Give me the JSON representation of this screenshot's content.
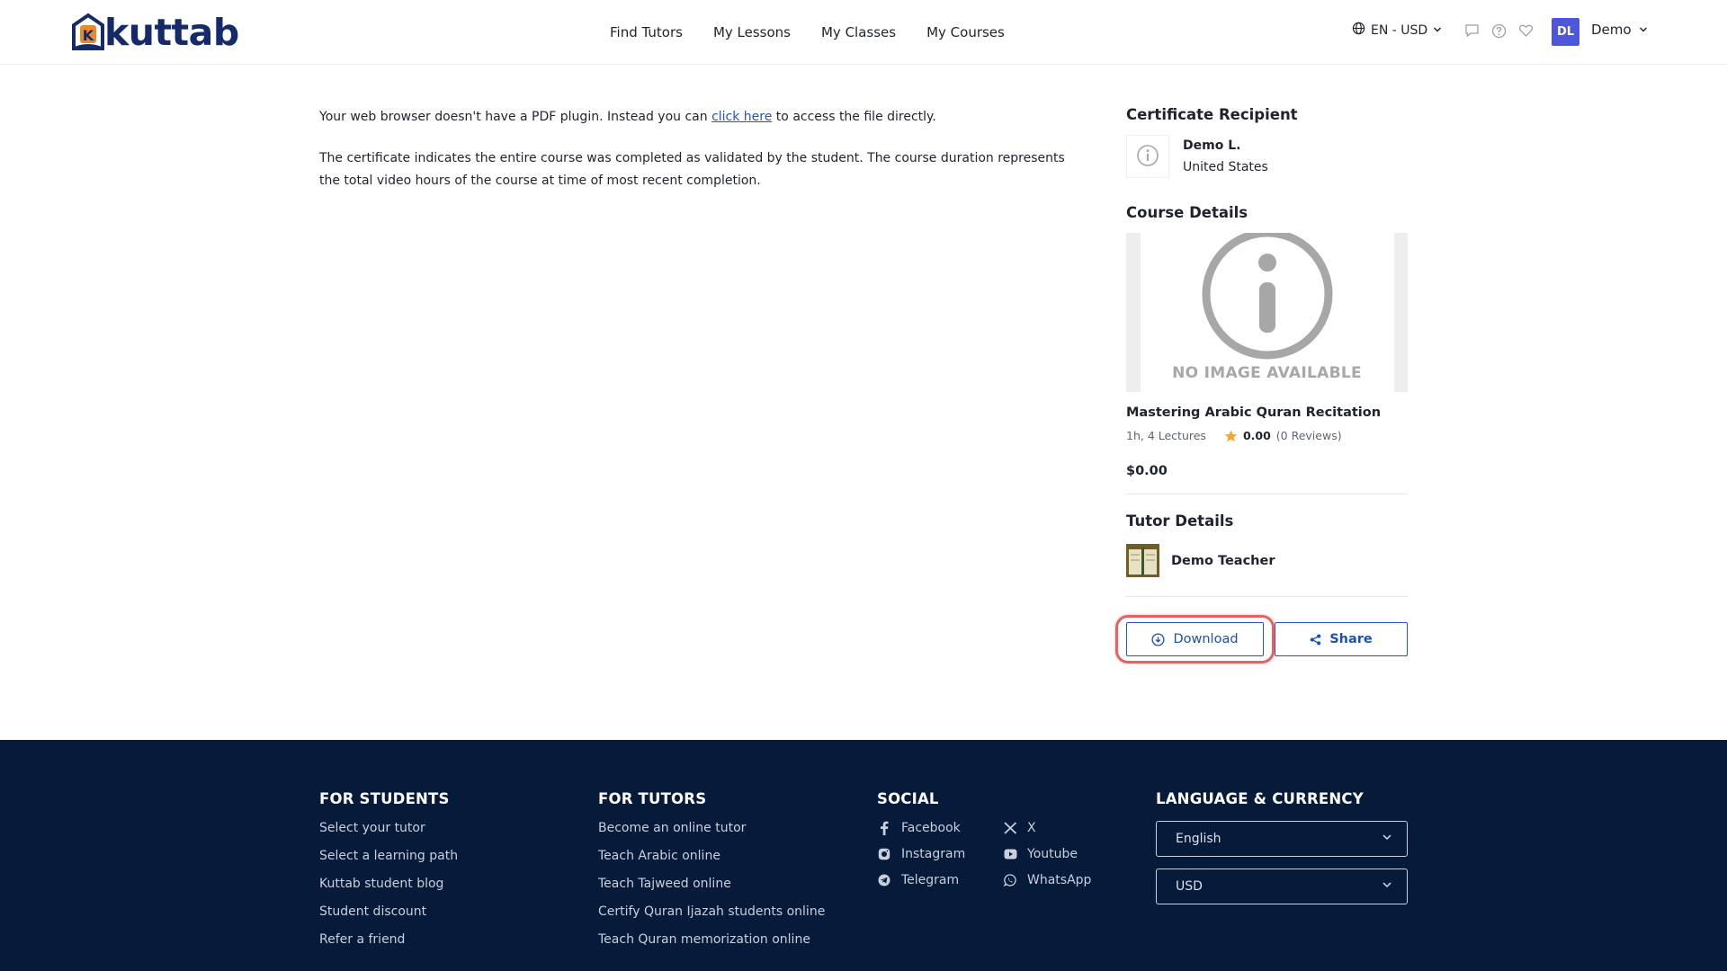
{
  "header": {
    "logo_text": "kuttab",
    "nav": [
      "Find Tutors",
      "My Lessons",
      "My Classes",
      "My Courses"
    ],
    "lang_currency": "EN - USD",
    "avatar_initials": "DL",
    "user_name": "Demo"
  },
  "main": {
    "pdf_notice_before": "Your web browser doesn't have a PDF plugin. Instead you can ",
    "pdf_notice_link": "click here",
    "pdf_notice_after": " to access the file directly.",
    "certificate_note": "The certificate indicates the entire course was completed as validated by the student. The course duration represents the total video hours of the course at time of most recent completion."
  },
  "sidebar": {
    "recipient_title": "Certificate Recipient",
    "recipient_name": "Demo L.",
    "recipient_country": "United States",
    "course_title_heading": "Course Details",
    "no_image_text": "NO IMAGE AVAILABLE",
    "course_name": "Mastering Arabic Quran Recitation",
    "course_meta": "1h, 4 Lectures",
    "rating": "0.00",
    "reviews": "(0 Reviews)",
    "price": "$0.00",
    "tutor_heading": "Tutor Details",
    "tutor_name": "Demo Teacher",
    "download_label": "Download",
    "share_label": "Share"
  },
  "footer": {
    "students_title": "FOR STUDENTS",
    "students_links": [
      "Select your tutor",
      "Select a learning path",
      "Kuttab student blog",
      "Student discount",
      "Refer a friend"
    ],
    "tutors_title": "FOR TUTORS",
    "tutors_links": [
      "Become an online tutor",
      "Teach Arabic online",
      "Teach Tajweed online",
      "Certify Quran Ijazah students online",
      "Teach Quran memorization online"
    ],
    "social_title": "SOCIAL",
    "social": [
      {
        "label": "Facebook",
        "icon": "facebook-icon"
      },
      {
        "label": "X",
        "icon": "x-icon"
      },
      {
        "label": "Instagram",
        "icon": "instagram-icon"
      },
      {
        "label": "Youtube",
        "icon": "youtube-icon"
      },
      {
        "label": "Telegram",
        "icon": "telegram-icon"
      },
      {
        "label": "WhatsApp",
        "icon": "whatsapp-icon"
      }
    ],
    "lang_title": "LANGUAGE & CURRENCY",
    "language_value": "English",
    "currency_value": "USD"
  },
  "colors": {
    "brand_navy": "#152a6b",
    "accent_blue": "#2653c8",
    "avatar_bg": "#4e56d9",
    "footer_bg": "#061a3a",
    "highlight_red": "#e06461",
    "star": "#f5a623"
  }
}
